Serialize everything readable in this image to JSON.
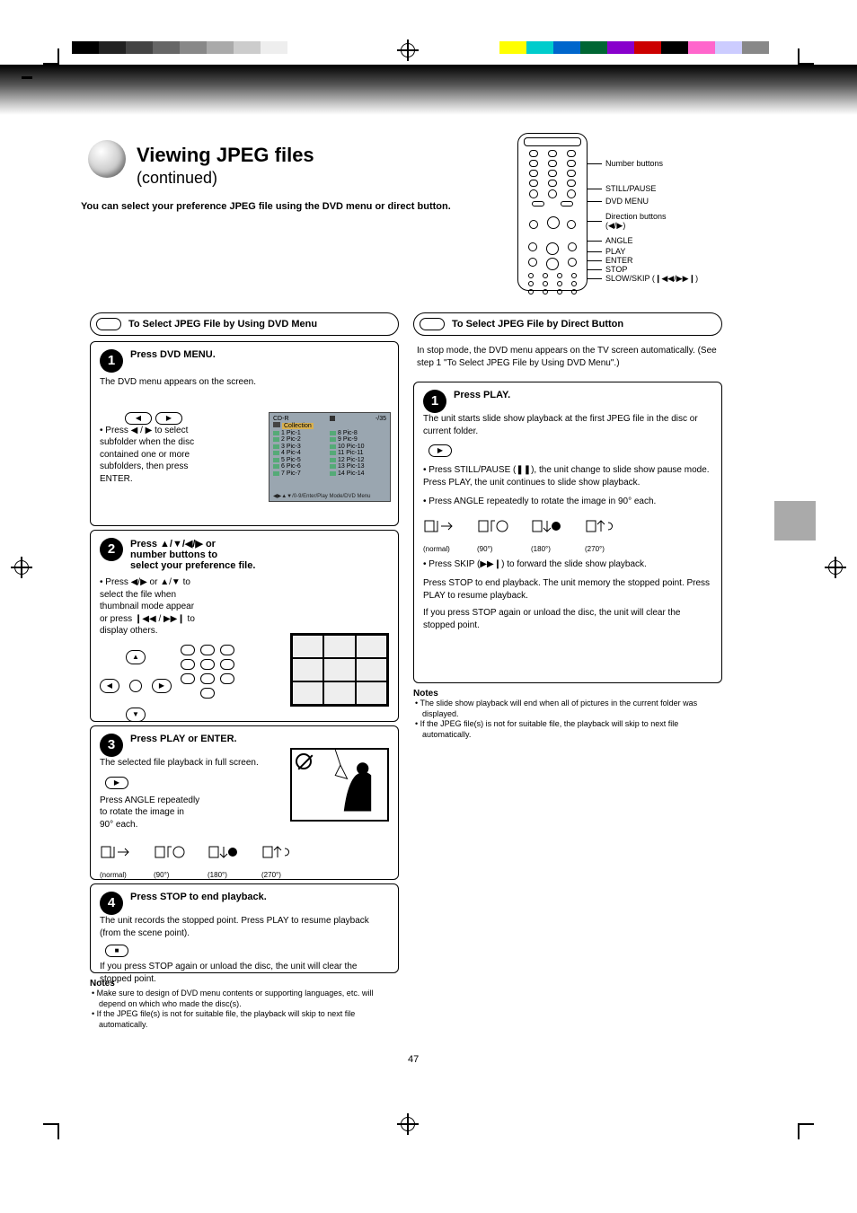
{
  "page_title_line1": "Viewing JPEG files",
  "page_title_line2": "(continued)",
  "intro_text": "You can select your preference JPEG file using the DVD menu or direct button.",
  "page_number": "47",
  "remote_labels": {
    "l1": "Number buttons",
    "l2": "STILL/PAUSE",
    "l3": "DVD MENU",
    "l4a": "Direction buttons",
    "l4b": "(◀/▶)",
    "l5": "ANGLE",
    "l6": "PLAY",
    "l7": "ENTER",
    "l8": "STOP",
    "l9": "SLOW/SKIP (❙◀◀/▶▶❙)"
  },
  "procA_title": "To Select JPEG File by Using DVD Menu",
  "procB_title": "To Select JPEG File by Direct Button",
  "boxA1": {
    "title": "Press DVD MENU.",
    "line1": "The DVD menu appears on the screen.",
    "line2a": "• Press ◀ / ▶ to select",
    "line2b": "subfolder when the disc",
    "line2c": "contained one or more",
    "line2d": "subfolders, then press",
    "line2e": "ENTER."
  },
  "osd": {
    "header_left": "CD-R",
    "header_right": "-/35",
    "folder": "Collection",
    "rows_left": [
      "1   Pic-1",
      "2   Pic-2",
      "3   Pic-3",
      "4   Pic-4",
      "5   Pic-5",
      "6   Pic-6",
      "7   Pic-7"
    ],
    "rows_right": [
      "8   Pic-8",
      "9   Pic-9",
      "10  Pic-10",
      "11  Pic-11",
      "12  Pic-12",
      "13  Pic-13",
      "14  Pic-14"
    ],
    "bottom": "◀▶▲▼/0-9/Enter/Play Mode/DVD Menu"
  },
  "boxA2": {
    "title_a": "Press ▲/▼/◀/▶ or",
    "title_b": "number buttons to",
    "title_c": "select your preference file.",
    "note_a": "• Press ◀/▶ or ▲/▼ to",
    "note_b": "select the file when",
    "note_c": "thumbnail mode appear",
    "note_d": "or press ❙◀◀ / ▶▶❙ to",
    "note_e": "display others."
  },
  "boxA3": {
    "title": "Press PLAY or ENTER.",
    "line1": "The selected file playback in full screen.",
    "line2a": "Press ANGLE repeatedly",
    "line2b": "to rotate the image in",
    "line2c": "90° each.",
    "rot": [
      "(normal)",
      "(90°)",
      "(180°)",
      "(270°)"
    ]
  },
  "boxA4": {
    "title": "Press STOP to end playback.",
    "line1": "The unit records the stopped point. Press PLAY to resume playback (from the scene point).",
    "line2": "If you press STOP again or unload the disc, the unit will clear the stopped point."
  },
  "notesA": {
    "h": "Notes",
    "n1": "• Make sure to design of DVD menu contents or supporting languages, etc. will depend on which who made the disc(s).",
    "n2": "• If the JPEG file(s) is not for suitable file, the playback will skip to next file automatically."
  },
  "boxB1": {
    "lead": "In stop mode, the DVD menu appears on the TV screen automatically. (See step 1 \"To Select JPEG File by Using DVD Menu\".)",
    "title": "Press PLAY.",
    "l1": "The unit starts slide show playback at the first JPEG file in the disc or current folder.",
    "l2": "• Press STILL/PAUSE (❚❚), the unit change to slide show pause mode. Press PLAY, the unit continues to slide show playback.",
    "l3": "• Press ANGLE repeatedly to rotate the image in 90° each.",
    "rot": [
      "(normal)",
      "(90°)",
      "(180°)",
      "(270°)"
    ],
    "l4": "• Press SKIP (▶▶❙) to forward the slide show playback.",
    "l5": "Press STOP to end playback. The unit memory the stopped point. Press PLAY to resume playback.",
    "l6": "If you press STOP again or unload the disc, the unit will clear the stopped point."
  },
  "notesB": {
    "h": "Notes",
    "n1": "• The slide show playback will end when all of pictures in the current folder was displayed.",
    "n2": "• If the JPEG file(s) is not for suitable file, the playback will skip to next file automatically."
  }
}
